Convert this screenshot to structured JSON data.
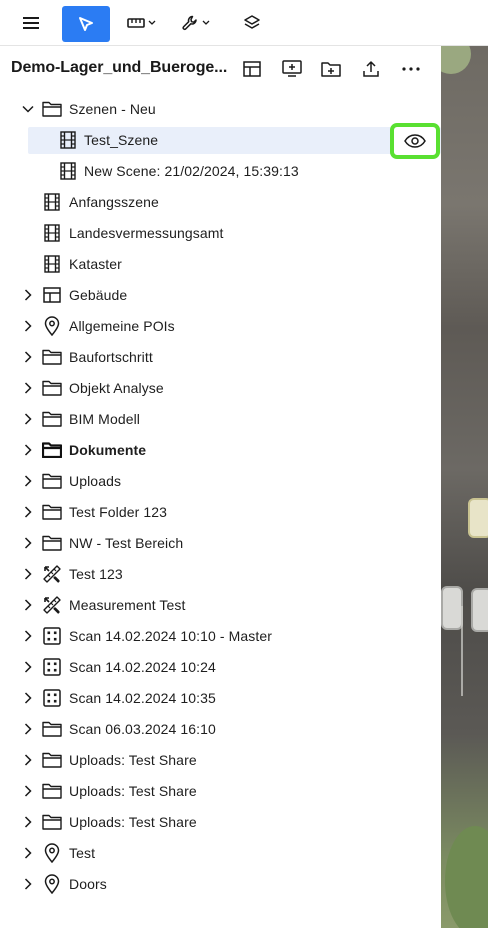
{
  "toolbar": {
    "menu_icon": "hamburger-icon",
    "select_icon": "cursor-arrow-icon",
    "measure_icon": "ruler-icon",
    "tools_icon": "wrench-icon",
    "layers_icon": "layers-icon",
    "accent_color": "#2b7cf3"
  },
  "panel": {
    "title": "Demo-Lager_und_Bueroge...",
    "actions": [
      "layout-grid-icon",
      "add-screen-icon",
      "add-folder-icon",
      "upload-icon",
      "more-icon"
    ]
  },
  "tree": {
    "items": [
      {
        "label": "Szenen - Neu",
        "icon": "folder-icon",
        "expanded": true
      },
      {
        "label": "Test_Szene",
        "icon": "film-icon",
        "selected": true
      },
      {
        "label": "New Scene: 21/02/2024, 15:39:13",
        "icon": "film-icon"
      },
      {
        "label": "Anfangsszene",
        "icon": "film-icon"
      },
      {
        "label": "Landesvermessungsamt",
        "icon": "film-icon"
      },
      {
        "label": "Kataster",
        "icon": "film-icon"
      },
      {
        "label": "Gebäude",
        "icon": "building-grid-icon"
      },
      {
        "label": "Allgemeine POIs",
        "icon": "map-pin-icon"
      },
      {
        "label": "Baufortschritt",
        "icon": "folder-icon"
      },
      {
        "label": "Objekt Analyse",
        "icon": "folder-icon"
      },
      {
        "label": "BIM Modell",
        "icon": "folder-icon"
      },
      {
        "label": "Dokumente",
        "icon": "folder-bold-icon"
      },
      {
        "label": "Uploads",
        "icon": "folder-icon"
      },
      {
        "label": "Test Folder 123",
        "icon": "folder-icon"
      },
      {
        "label": "NW - Test Bereich",
        "icon": "folder-icon"
      },
      {
        "label": "Test 123",
        "icon": "measure-tools-icon"
      },
      {
        "label": "Measurement Test",
        "icon": "measure-tools-icon"
      },
      {
        "label": "Scan 14.02.2024 10:10 - Master",
        "icon": "scan-grid-icon"
      },
      {
        "label": "Scan 14.02.2024 10:24",
        "icon": "scan-grid-icon"
      },
      {
        "label": "Scan 14.02.2024 10:35",
        "icon": "scan-grid-icon"
      },
      {
        "label": "Scan 06.03.2024 16:10",
        "icon": "folder-icon"
      },
      {
        "label": "Uploads: Test Share",
        "icon": "folder-icon"
      },
      {
        "label": "Uploads: Test Share",
        "icon": "folder-icon"
      },
      {
        "label": "Uploads: Test Share",
        "icon": "folder-icon"
      },
      {
        "label": "Test",
        "icon": "map-pin-icon"
      },
      {
        "label": "Doors",
        "icon": "map-pin-icon"
      }
    ]
  },
  "visibility_toggle": {
    "icon": "eye-icon",
    "highlight_color": "#59e031"
  }
}
